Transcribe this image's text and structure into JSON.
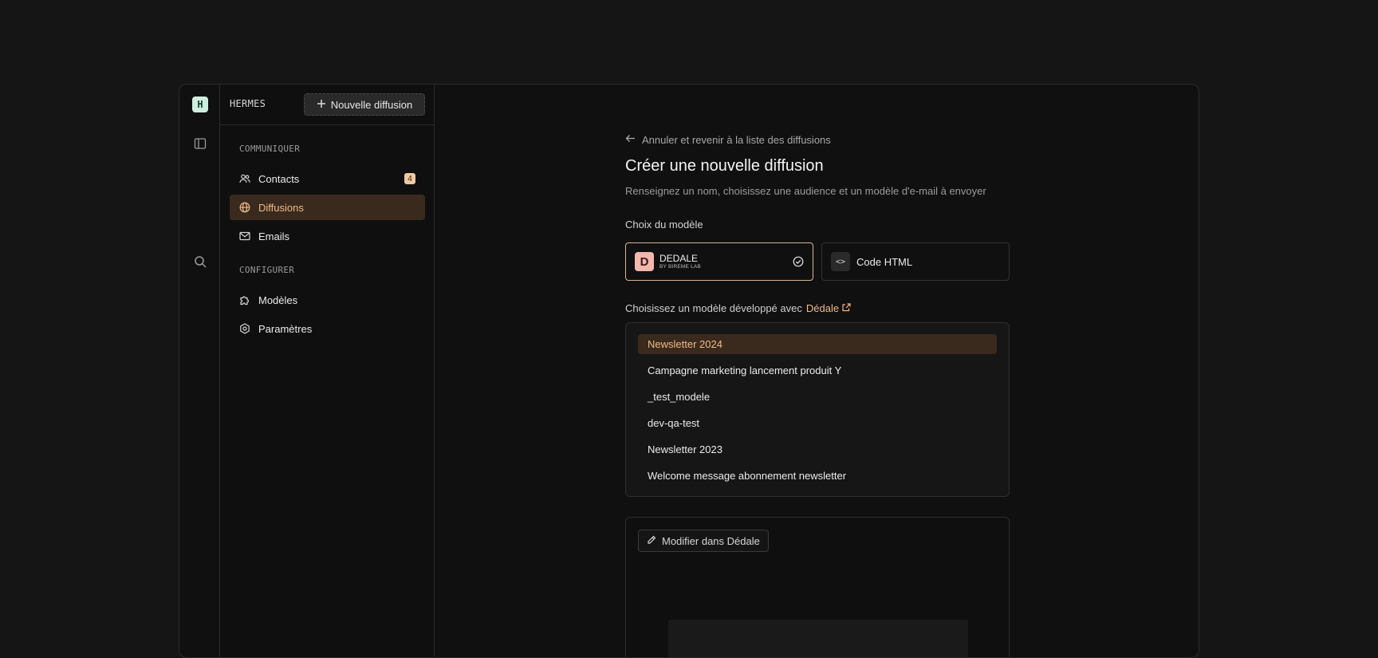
{
  "app": {
    "logo_letter": "H",
    "brand": "HERMES",
    "new_button_label": "Nouvelle diffusion"
  },
  "sidebar": {
    "sections": [
      {
        "label": "COMMUNIQUER",
        "items": [
          {
            "label": "Contacts",
            "icon": "users-icon",
            "badge": "4"
          },
          {
            "label": "Diffusions",
            "icon": "globe-icon",
            "active": true
          },
          {
            "label": "Emails",
            "icon": "mail-icon"
          }
        ]
      },
      {
        "label": "CONFIGURER",
        "items": [
          {
            "label": "Modèles",
            "icon": "puzzle-icon"
          },
          {
            "label": "Paramètres",
            "icon": "settings-icon"
          }
        ]
      }
    ]
  },
  "main": {
    "back_link": "Annuler et revenir à la liste des diffusions",
    "title": "Créer une nouvelle diffusion",
    "subtitle": "Renseignez un nom, choisissez une audience et un modèle d'e-mail à envoyer",
    "model_choice_label": "Choix du modèle",
    "options": {
      "dedale": {
        "logo": "D",
        "name": "DEDALE",
        "byline": "BY BIREME LAB",
        "selected": true
      },
      "html": {
        "icon_text": "<>",
        "label": "Code HTML"
      }
    },
    "choose_text": "Choisissez un modèle développé avec",
    "choose_link": "Dédale",
    "templates": [
      "Newsletter 2024",
      "Campagne marketing lancement produit Y",
      "_test_modele",
      "dev-qa-test",
      "Newsletter 2023",
      "Welcome message abonnement newsletter"
    ],
    "selected_template": "Newsletter 2024",
    "edit_button": "Modifier dans Dédale"
  },
  "colors": {
    "accent": "#f0b98a",
    "active_bg": "#3a2a1d",
    "logo_bg": "#cfeee0",
    "dedale_logo": "#f4b7ae",
    "background": "#151515"
  }
}
